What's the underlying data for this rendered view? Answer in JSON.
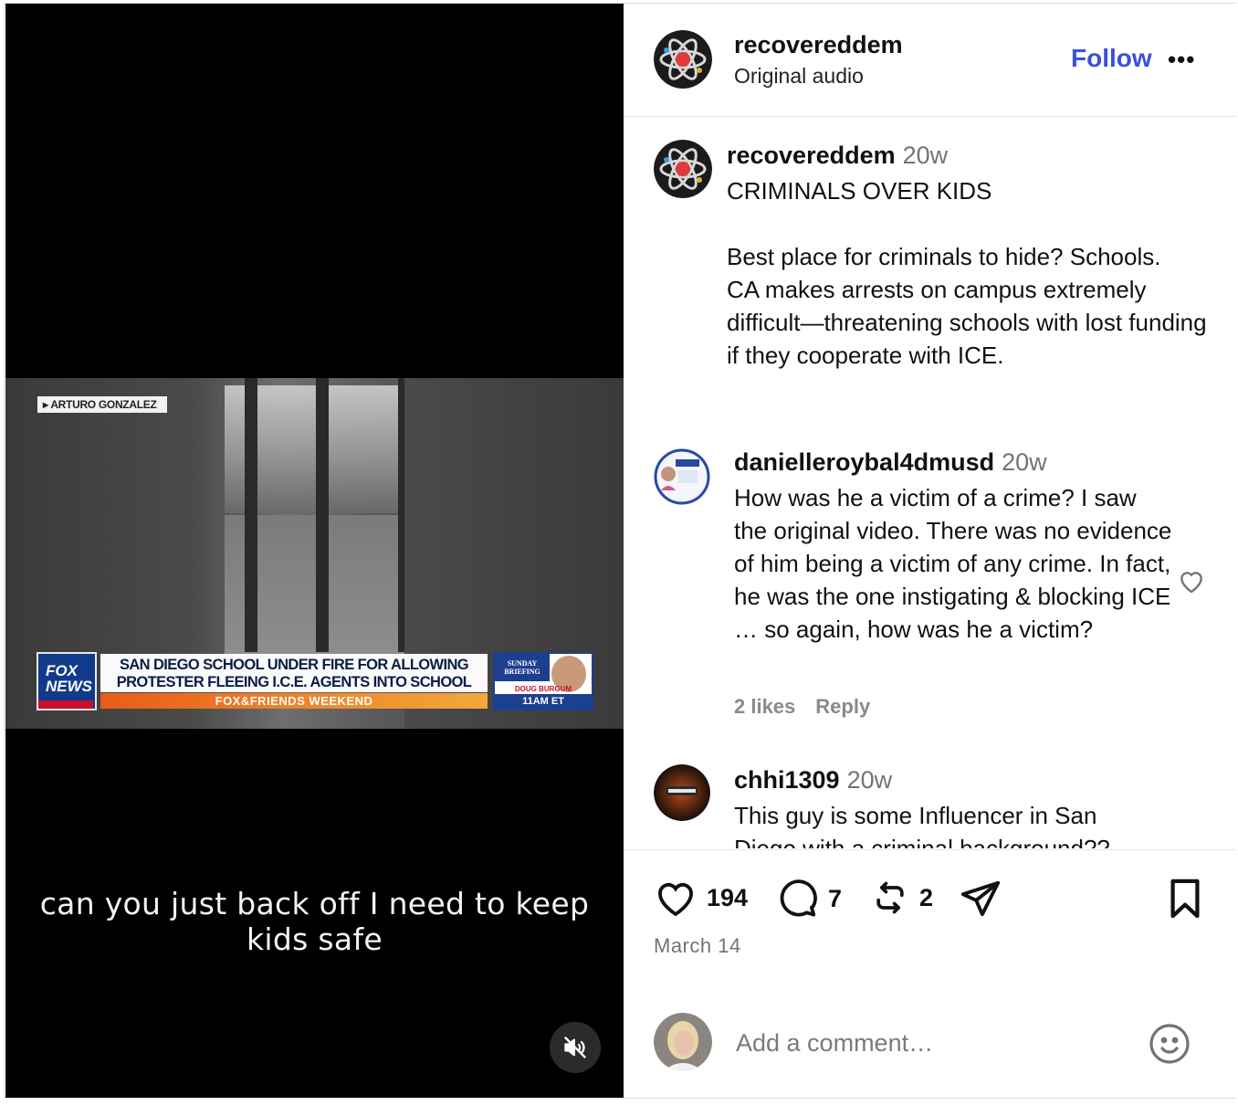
{
  "video": {
    "reporter_tag": "ARTURO GONZALEZ",
    "network_logo": "FOX NEWS",
    "headline": "SAN DIEGO SCHOOL UNDER FIRE FOR ALLOWING PROTESTER FLEEING I.C.E. AGENTS INTO SCHOOL",
    "ticker": "FOX&FRIENDS WEEKEND",
    "promo_top": "SUNDAY BRIEFING",
    "promo_name": "DOUG BURGUM",
    "promo_time": "11AM ET",
    "caption": "can you just back off I need to keep kids safe",
    "mute_icon": "muted-speaker-icon"
  },
  "header": {
    "username": "recovereddem",
    "audio": "Original audio",
    "follow_label": "Follow",
    "more_label": "•••"
  },
  "post": {
    "username": "recovereddem",
    "time": "20w",
    "text": "CRIMINALS OVER KIDS\n\nBest place for criminals to hide? Schools.\nCA makes arrests on campus extremely difficult—threatening schools with lost funding if they cooperate with ICE."
  },
  "comments": [
    {
      "username": "danielleroybal4dmusd",
      "time": "20w",
      "text": "How was he a victim of a crime? I saw the original video. There was no evidence of him being a victim of any crime. In fact, he was the one instigating & blocking ICE … so again, how was he a victim?",
      "likes": "2 likes",
      "reply": "Reply"
    },
    {
      "username": "chhi1309",
      "time": "20w",
      "text": "This guy is some Influencer in San Diego with a criminal background??"
    }
  ],
  "actions": {
    "likes": "194",
    "comments": "7",
    "reposts": "2",
    "date": "March 14"
  },
  "composer": {
    "placeholder": "Add a comment…"
  },
  "colors": {
    "accent": "#3b4fe0",
    "muted": "#737373"
  }
}
